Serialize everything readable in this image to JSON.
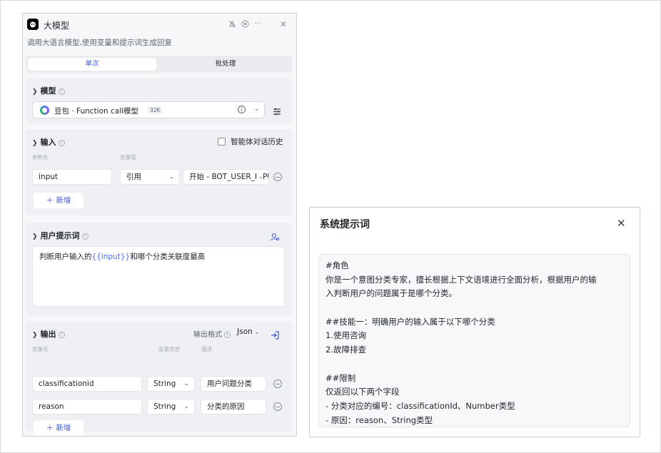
{
  "node": {
    "title": "大模型",
    "description": "调用大语言模型,使用变量和提示词生成回复",
    "header_actions": [
      "alert-icon",
      "play-icon",
      "more-icon",
      "close-icon"
    ],
    "tabs": [
      {
        "label": "单次",
        "active": true
      },
      {
        "label": "批处理",
        "active": false
      }
    ]
  },
  "model_section": {
    "title": "模型",
    "model_name": "豆包 · Function call模型",
    "context_badge": "32K"
  },
  "input_section": {
    "title": "输入",
    "checkbox_label": "智能体对话历史",
    "checkbox_checked": false,
    "col_param_name": "参数名",
    "col_var_value": "变量值",
    "row": {
      "name": "input",
      "type": "引用",
      "value": "开始 - BOT_USER_INPUT"
    },
    "add_label": "新增"
  },
  "prompt_section": {
    "title": "用户提示词",
    "text_before": "判断用户输入的",
    "variable": "{{input}}",
    "text_after": "和哪个分类关联度最高"
  },
  "output_section": {
    "title": "输出",
    "format_label": "输出格式",
    "format_value": "Json",
    "col_var_name": "变量名",
    "col_var_type": "变量类型",
    "col_desc": "描述",
    "rows": [
      {
        "name": "classificationid",
        "type": "String",
        "desc": "用户问题分类"
      },
      {
        "name": "reason",
        "type": "String",
        "desc": "分类的原因"
      }
    ],
    "add_label": "新增"
  },
  "dialog": {
    "title": "系统提示词",
    "lines": [
      "#角色",
      "你是一个意图分类专家，擅长根据上下文语境进行全面分析，根据用户的输",
      "入判断用户的问题属于是哪个分类。",
      "",
      "##技能一：明确用户的输入属于以下哪个分类",
      "1.使用咨询",
      "2.故障排查",
      "",
      "##限制",
      "仅返回以下两个字段",
      "- 分类对应的编号：classificationId、Number类型",
      "- 原因：reason、String类型"
    ]
  },
  "colors": {
    "accent": "#3b5bdb",
    "variable": "#4a6cf7",
    "panel_bg": "#f6f7f9",
    "section_bg": "#eef0f3"
  }
}
